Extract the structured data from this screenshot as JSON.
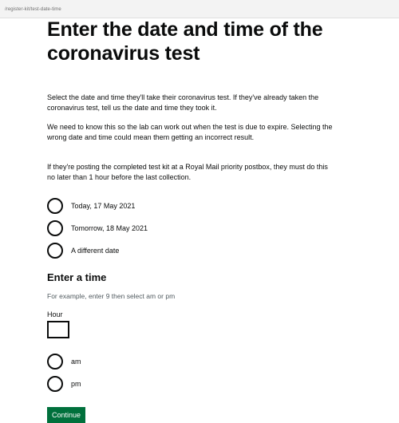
{
  "browser": {
    "url": "/register-kit/test-date-time"
  },
  "page": {
    "title": "Enter the date and time of the coronavirus test",
    "paragraphs": [
      "Select the date and time they'll take their coronavirus test. If they've already taken the coronavirus test, tell us the date and time they took it.",
      "We need to know this so the lab can work out when the test is due to expire. Selecting the wrong date and time could mean them getting an incorrect result.",
      "If they're posting the completed test kit at a Royal Mail priority postbox, they must do this no later than 1 hour before the last collection."
    ]
  },
  "date_options": [
    {
      "label": "Today, 17 May 2021",
      "selected": false
    },
    {
      "label": "Tomorrow, 18 May 2021",
      "selected": false
    },
    {
      "label": "A different date",
      "selected": false
    }
  ],
  "time": {
    "heading": "Enter a time",
    "hint": "For example, enter 9 then select am or pm",
    "hour_label": "Hour",
    "hour_value": "",
    "period_options": [
      {
        "label": "am",
        "selected": false
      },
      {
        "label": "pm",
        "selected": false
      }
    ]
  },
  "continue_label": "Continue",
  "colors": {
    "text": "#0b0c0c",
    "hint": "#505a5f",
    "button": "#00703c",
    "button_shadow": "#002d18"
  }
}
